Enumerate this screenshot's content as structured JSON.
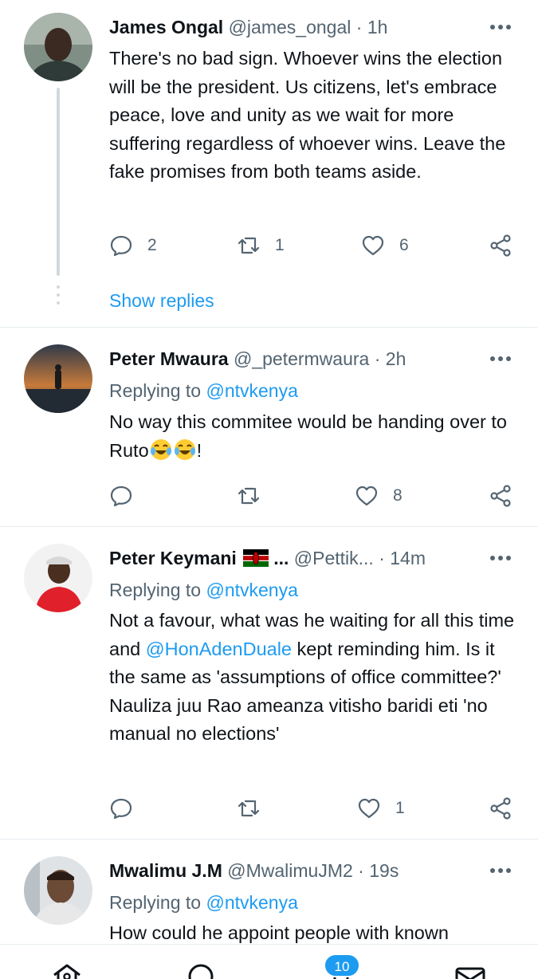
{
  "tweets": [
    {
      "name": "James Ongal",
      "handle": "@james_ongal",
      "dot": "·",
      "time": "1h",
      "text": "There's no bad sign. Whoever wins the election will be the president. Us citizens, let's embrace peace, love and unity as we wait for more suffering regardless of whoever wins. Leave the fake promises from both teams aside.",
      "replies": "2",
      "retweets": "1",
      "likes": "6",
      "show_replies": "Show replies"
    },
    {
      "name": "Peter Mwaura",
      "handle": "@_petermwaura",
      "dot": "·",
      "time": "2h",
      "replying_prefix": "Replying to ",
      "replying_to": "@ntvkenya",
      "text": "No way this commitee would be handing over to Ruto",
      "text_suffix": "!",
      "replies": "",
      "retweets": "",
      "likes": "8"
    },
    {
      "name": "Peter Keymani",
      "name_ellipsis": "...",
      "handle": "@Pettik...",
      "dot": "·",
      "time": "14m",
      "replying_prefix": "Replying to ",
      "replying_to": "@ntvkenya",
      "text_part1": "Not a favour, what was he waiting for  all this time and ",
      "mention": "@HonAdenDuale",
      "text_part2": " kept reminding him. Is it the same as 'assumptions of office committee?' Nauliza juu Rao ameanza vitisho baridi eti 'no manual no elections'",
      "replies": "",
      "retweets": "",
      "likes": "1"
    },
    {
      "name": "Mwalimu J.M",
      "handle": "@MwalimuJM2",
      "dot": "·",
      "time": "19s",
      "replying_prefix": "Replying to ",
      "replying_to": "@ntvkenya",
      "text": "How could he appoint people with known"
    }
  ],
  "icons": {
    "reply": "reply-bubble-icon",
    "retweet": "retweet-icon",
    "like": "heart-icon",
    "share": "share-icon",
    "more": "more-dots-icon",
    "home": "home-icon",
    "search": "search-icon",
    "notifications": "bell-icon",
    "messages": "mail-icon"
  },
  "bottom_nav": {
    "notifications_badge": "10"
  },
  "colors": {
    "accent": "#1d9bf0",
    "secondary_text": "#536471",
    "divider": "#e6ecf0"
  }
}
